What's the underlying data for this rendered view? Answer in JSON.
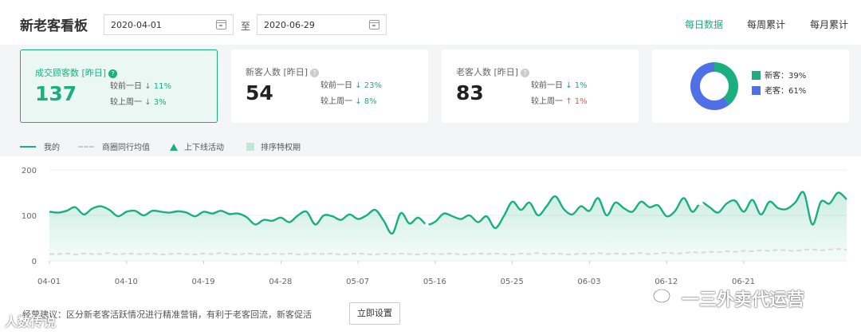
{
  "header": {
    "title": "新老客看板",
    "start_date": "2020-04-01",
    "to_label": "至",
    "end_date": "2020-06-29",
    "tabs": [
      {
        "label": "每日数据",
        "active": true
      },
      {
        "label": "每周累计",
        "active": false
      },
      {
        "label": "每月累计",
        "active": false
      }
    ]
  },
  "cards": [
    {
      "label": "成交顾客数 [昨日]",
      "value": "137",
      "day_label": "较前一日",
      "day_dir": "down",
      "day_value": "11%",
      "week_label": "较上周一",
      "week_dir": "down",
      "week_value": "3%"
    },
    {
      "label": "新客人数 [昨日]",
      "value": "54",
      "day_label": "较前一日",
      "day_dir": "down",
      "day_value": "23%",
      "week_label": "较上周一",
      "week_dir": "down",
      "week_value": "8%"
    },
    {
      "label": "老客人数 [昨日]",
      "value": "83",
      "day_label": "较前一日",
      "day_dir": "down",
      "day_value": "1%",
      "week_label": "较上周一",
      "week_dir": "up",
      "week_value": "1%"
    }
  ],
  "donut": {
    "legend": [
      {
        "label": "新客：39%",
        "value": 39,
        "color": "#1aaf7f"
      },
      {
        "label": "老客：61%",
        "value": 61,
        "color": "#4f6fe6"
      }
    ]
  },
  "legend": {
    "mine": "我的",
    "avg": "商圈同行均值",
    "activity": "上下线活动",
    "rank": "排序特权期"
  },
  "chart_data": {
    "type": "area",
    "x_ticks": [
      "04-01",
      "04-10",
      "04-19",
      "04-28",
      "05-07",
      "05-16",
      "05-25",
      "06-03",
      "06-12",
      "06-21"
    ],
    "y_ticks": [
      "200",
      "100",
      "0"
    ],
    "ylim": [
      0,
      200
    ],
    "series": [
      {
        "name": "我的",
        "values": [
          108,
          106,
          110,
          118,
          102,
          115,
          120,
          112,
          98,
          108,
          110,
          100,
          110,
          108,
          106,
          109,
          106,
          98,
          108,
          104,
          110,
          103,
          104,
          96,
          80,
          90,
          88,
          95,
          85,
          100,
          108,
          80,
          100,
          98,
          90,
          102,
          92,
          100,
          112,
          88,
          60,
          105,
          82,
          95,
          80,
          86,
          104,
          98,
          92,
          100,
          85,
          98,
          72,
          98,
          130,
          112,
          128,
          100,
          120,
          142,
          114,
          102,
          120,
          110,
          138,
          100,
          128,
          116,
          108,
          130,
          118,
          122,
          98,
          110,
          138,
          108,
          128,
          118,
          106,
          126,
          132,
          108,
          134,
          102,
          130,
          116,
          114,
          128,
          150,
          80,
          130,
          126,
          150,
          135
        ]
      },
      {
        "name": "商圈同行均值",
        "values": [
          15,
          15,
          16,
          14,
          16,
          15,
          15,
          17,
          14,
          16,
          15,
          15,
          16,
          14,
          15,
          16,
          15,
          14,
          16,
          15,
          17,
          15,
          14,
          16,
          15,
          14,
          16,
          15,
          16,
          14,
          15,
          16,
          15,
          16,
          14,
          15,
          16,
          15,
          14,
          16,
          15,
          16,
          15,
          14,
          16,
          15,
          15,
          16,
          14,
          15,
          16,
          15,
          16,
          15,
          14,
          16,
          15,
          17,
          15,
          16,
          15,
          14,
          16,
          15,
          17,
          15,
          16,
          15,
          16,
          17,
          15,
          16,
          18,
          16,
          17,
          19,
          18,
          20,
          19,
          21,
          20,
          22,
          21,
          23,
          22,
          24,
          23,
          22,
          24,
          25,
          23,
          25,
          26,
          24
        ]
      }
    ],
    "activity_markers": [
      44,
      76,
      100
    ]
  },
  "footer": {
    "tip": "经营建议：区分新老客活跃情况进行精准营销，有利于老客回流，新客促活",
    "button": "立即设置"
  },
  "watermark": {
    "right": "一三外卖代运营",
    "left": "人数传说"
  }
}
